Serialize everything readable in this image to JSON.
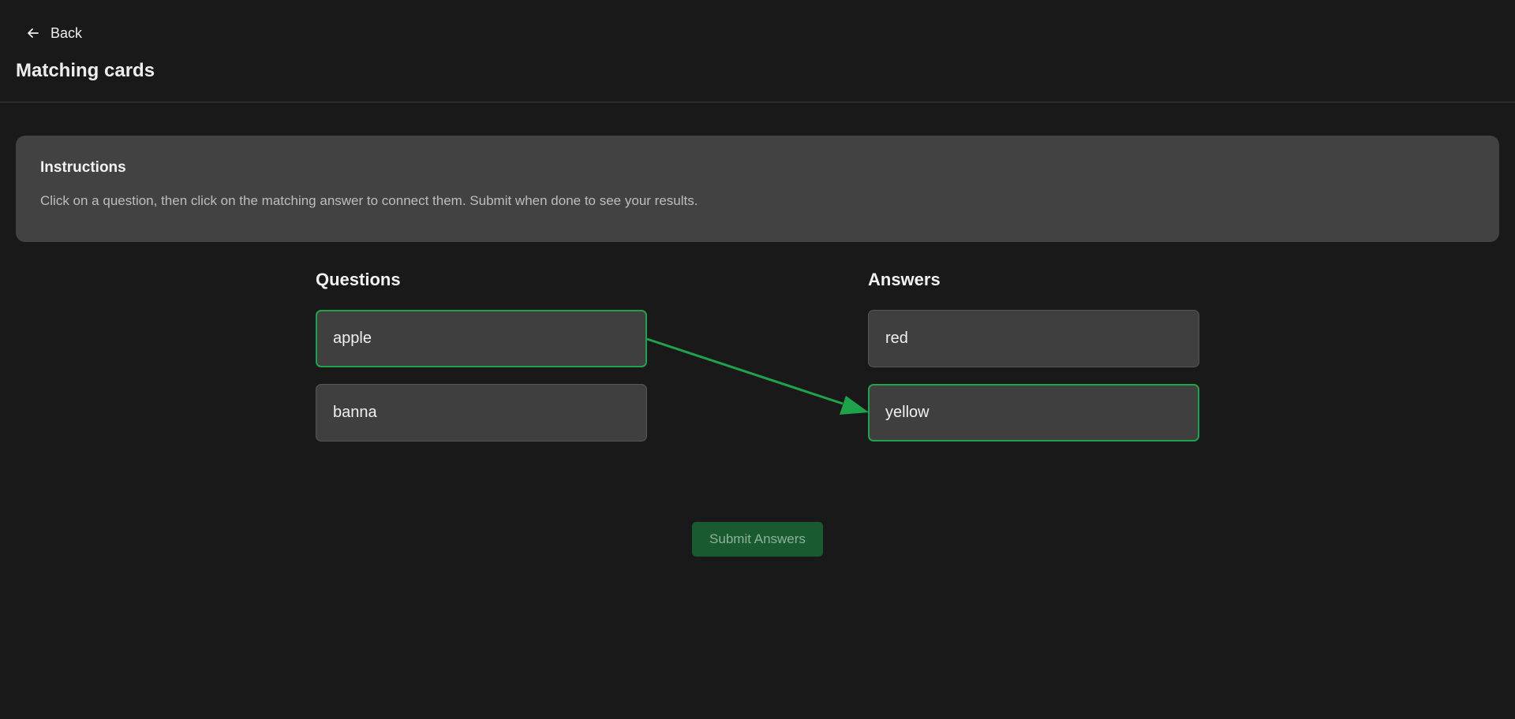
{
  "header": {
    "back_label": "Back",
    "back_icon": "arrow-left-icon",
    "title": "Matching cards"
  },
  "instructions": {
    "title": "Instructions",
    "text": "Click on a question, then click on the matching answer to connect them. Submit when done to see your results."
  },
  "questions": {
    "heading": "Questions",
    "items": [
      {
        "label": "apple",
        "matched": true
      },
      {
        "label": "banna",
        "matched": false
      }
    ]
  },
  "answers": {
    "heading": "Answers",
    "items": [
      {
        "label": "red",
        "matched": false
      },
      {
        "label": "yellow",
        "matched": true
      }
    ]
  },
  "connections": [
    {
      "question": "apple",
      "answer": "yellow"
    }
  ],
  "submit": {
    "label": "Submit Answers"
  },
  "colors": {
    "background": "#191919",
    "card": "#3f3f3f",
    "panel": "#424242",
    "accent": "#1fa34a",
    "submit_bg": "#1a5a31"
  }
}
